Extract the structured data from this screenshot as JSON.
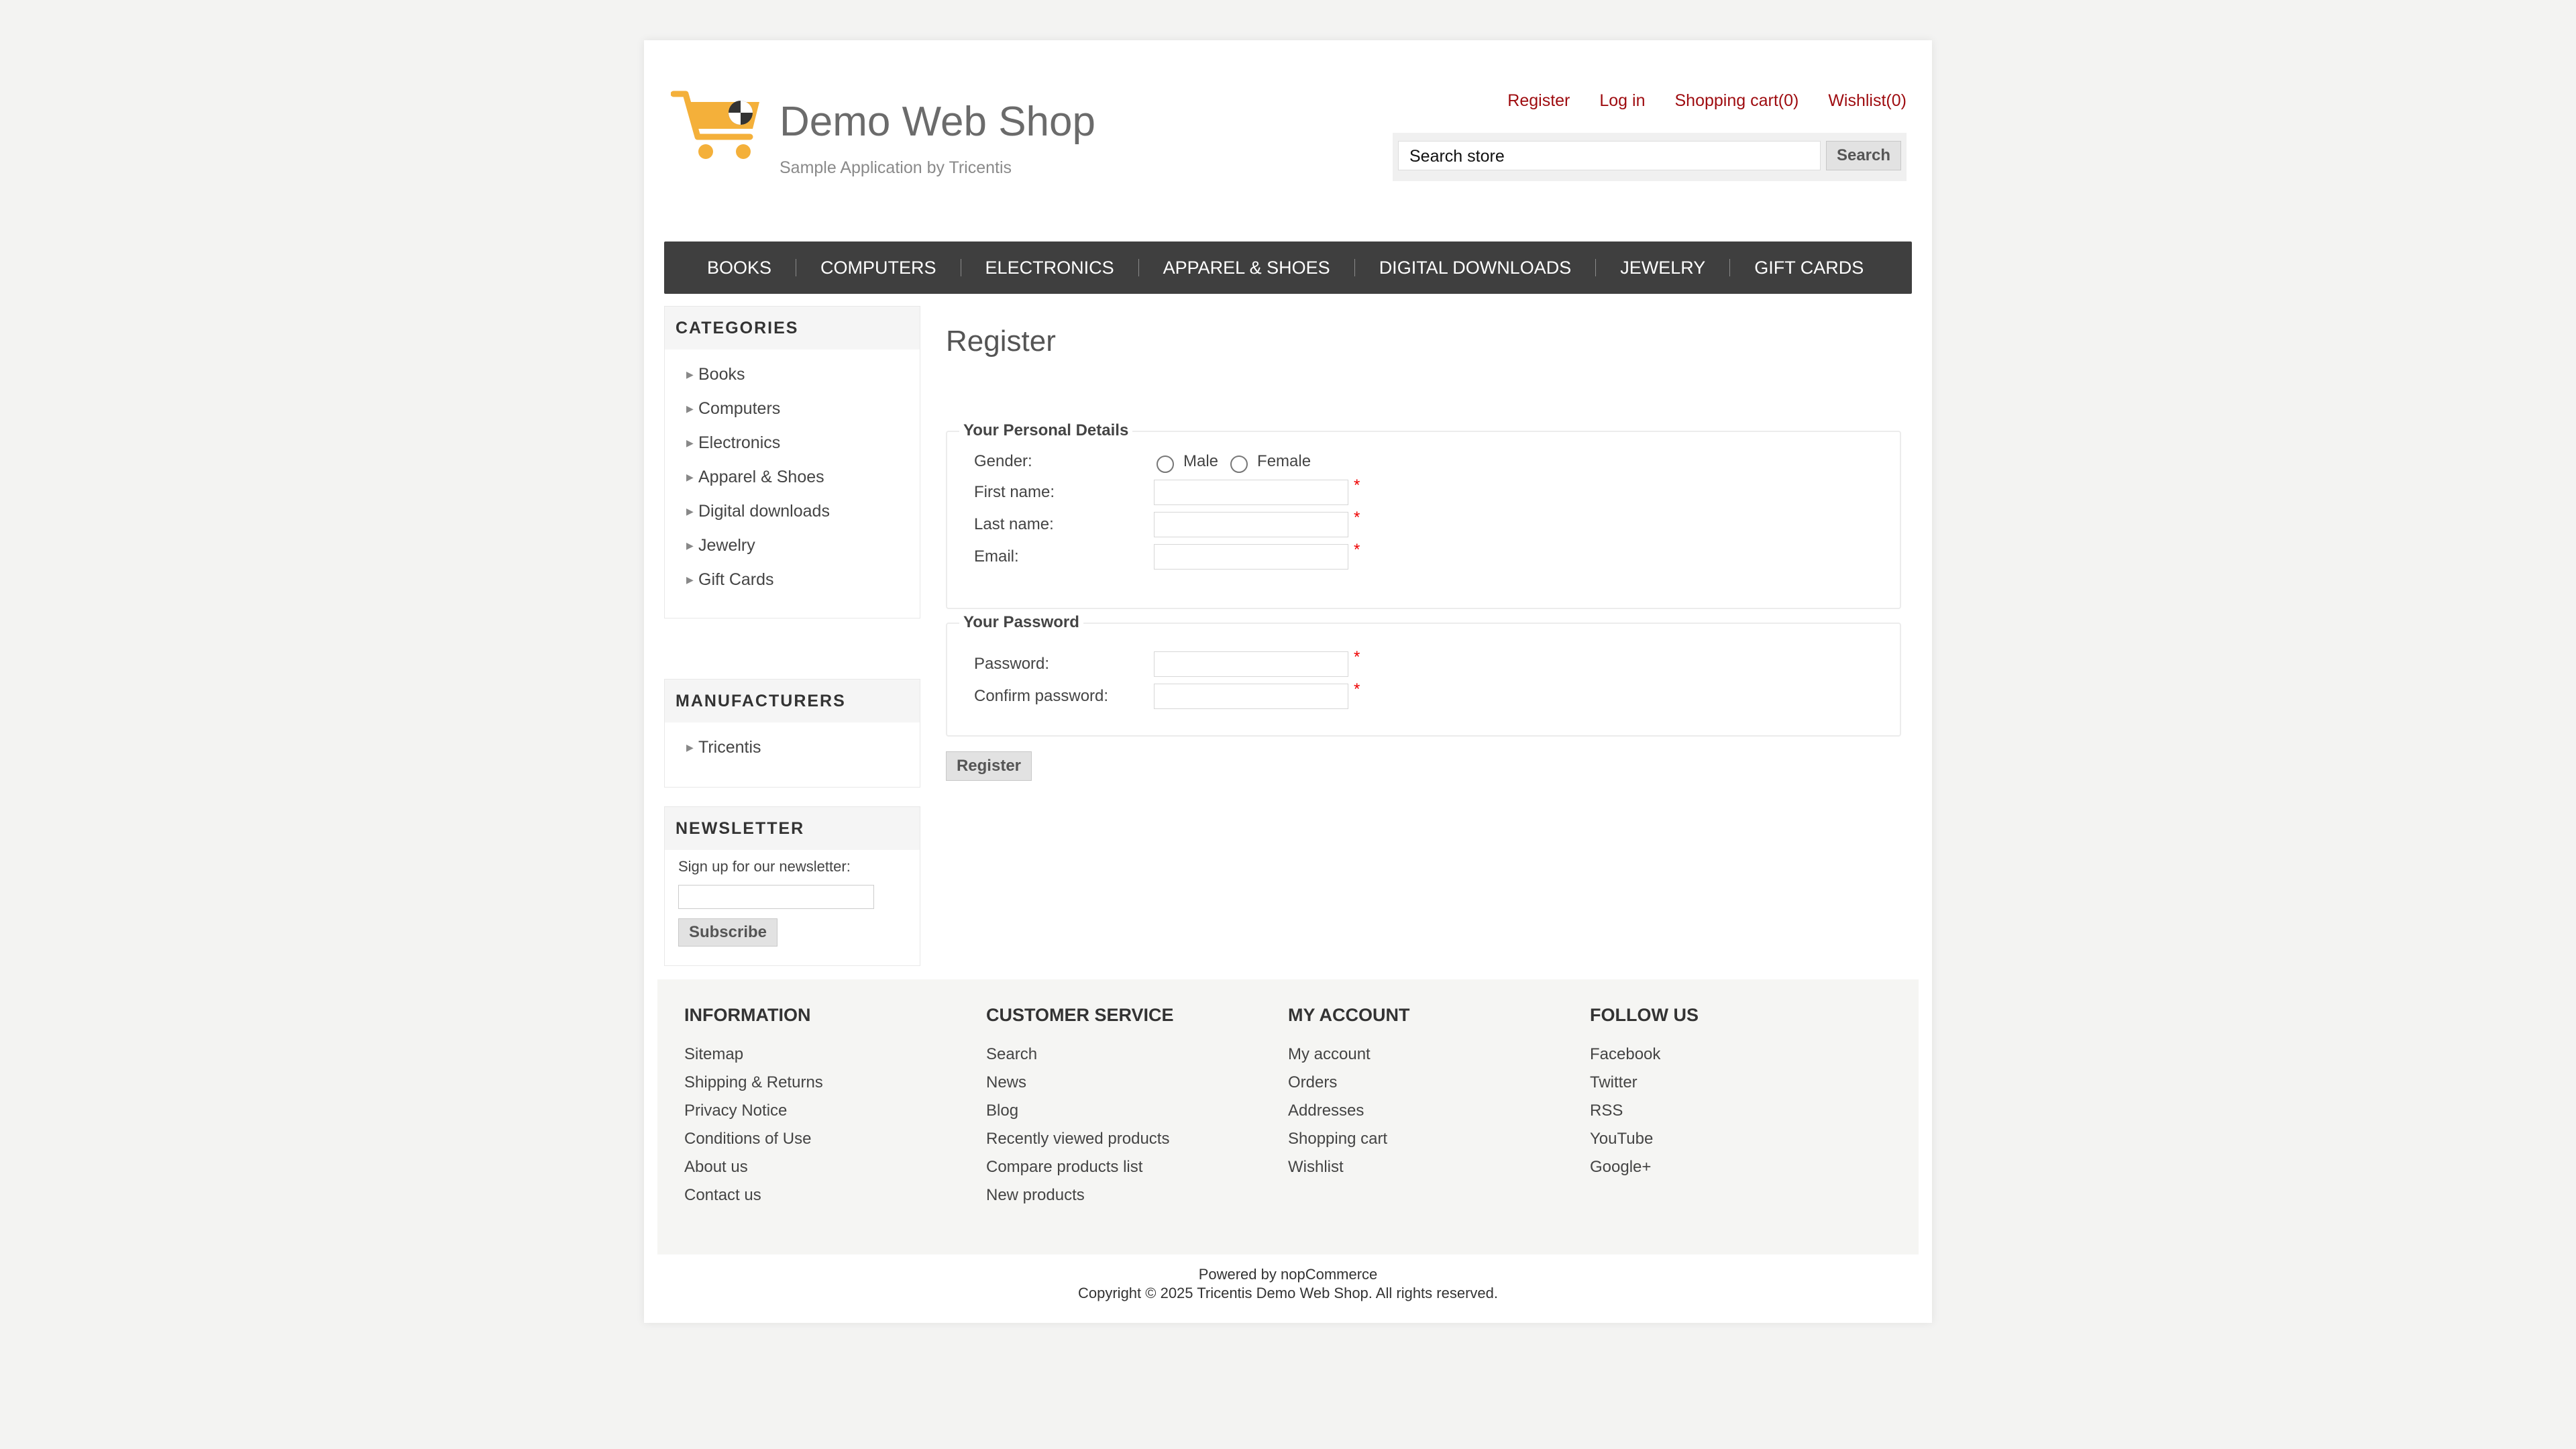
{
  "header": {
    "logo_title": "Demo Web Shop",
    "logo_subtitle": "Sample Application by Tricentis",
    "links": [
      "Register",
      "Log in",
      "Shopping cart(0)",
      "Wishlist(0)"
    ],
    "search_placeholder": "Search store",
    "search_button": "Search"
  },
  "menu": [
    "BOOKS",
    "COMPUTERS",
    "ELECTRONICS",
    "APPAREL & SHOES",
    "DIGITAL DOWNLOADS",
    "JEWELRY",
    "GIFT CARDS"
  ],
  "categories": {
    "title": "CATEGORIES",
    "items": [
      "Books",
      "Computers",
      "Electronics",
      "Apparel & Shoes",
      "Digital downloads",
      "Jewelry",
      "Gift Cards"
    ]
  },
  "manufacturers": {
    "title": "MANUFACTURERS",
    "items": [
      "Tricentis"
    ]
  },
  "newsletter": {
    "title": "NEWSLETTER",
    "label": "Sign up for our newsletter:",
    "button": "Subscribe"
  },
  "main": {
    "title": "Register",
    "personal": {
      "legend": "Your Personal Details",
      "gender_label": "Gender:",
      "male": "Male",
      "female": "Female",
      "first_name": "First name:",
      "last_name": "Last name:",
      "email": "Email:"
    },
    "password": {
      "legend": "Your Password",
      "password": "Password:",
      "confirm": "Confirm password:"
    },
    "required_mark": "*",
    "register_button": "Register"
  },
  "footer": {
    "information": {
      "title": "INFORMATION",
      "links": [
        "Sitemap",
        "Shipping & Returns",
        "Privacy Notice",
        "Conditions of Use",
        "About us",
        "Contact us"
      ]
    },
    "customer_service": {
      "title": "CUSTOMER SERVICE",
      "links": [
        "Search",
        "News",
        "Blog",
        "Recently viewed products",
        "Compare products list",
        "New products"
      ]
    },
    "my_account": {
      "title": "MY ACCOUNT",
      "links": [
        "My account",
        "Orders",
        "Addresses",
        "Shopping cart",
        "Wishlist"
      ]
    },
    "follow_us": {
      "title": "FOLLOW US",
      "links": [
        "Facebook",
        "Twitter",
        "RSS",
        "YouTube",
        "Google+"
      ]
    },
    "powered": "Powered by nopCommerce",
    "copyright": "Copyright © 2025 Tricentis Demo Web Shop. All rights reserved."
  },
  "colors": {
    "link_red": "#9e0b0f",
    "menu_bg": "#3f3f3f",
    "logo_orange": "#f4b03a"
  }
}
